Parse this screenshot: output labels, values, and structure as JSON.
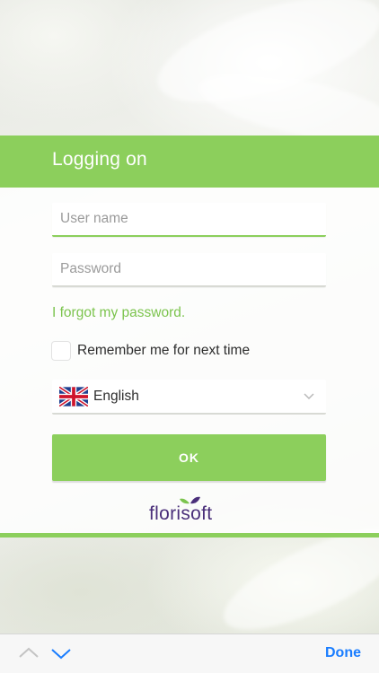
{
  "login": {
    "title": "Logging on",
    "username_placeholder": "User name",
    "password_placeholder": "Password",
    "forgot_label": "I forgot my password.",
    "remember_label": "Remember me for next time",
    "remember_checked": false,
    "language_selected": "English",
    "language_flag_icon": "uk-flag-icon",
    "ok_label": "OK"
  },
  "brand": {
    "logo_text": "florisoft",
    "primary_color": "#8ccf5c",
    "logo_color": "#4a2f7a"
  },
  "keyboard_toolbar": {
    "prev_icon": "chevron-up-icon",
    "next_icon": "chevron-down-icon",
    "done_label": "Done",
    "done_color": "#1a7dff"
  }
}
